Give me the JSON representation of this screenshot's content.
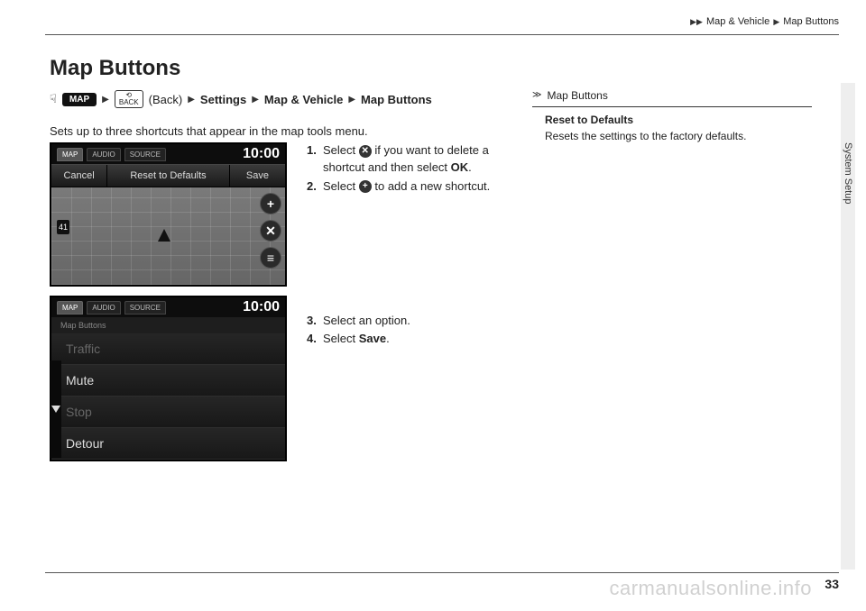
{
  "header": {
    "crumb1": "Map & Vehicle",
    "crumb2": "Map Buttons"
  },
  "title": "Map Buttons",
  "breadcrumb": {
    "map_pill": "MAP",
    "back_box_top": "⟲",
    "back_box_bottom": "BACK",
    "back_label": "(Back)",
    "settings": "Settings",
    "map_vehicle": "Map & Vehicle",
    "map_buttons": "Map Buttons"
  },
  "intro": "Sets up to three shortcuts that appear in the map tools menu.",
  "screenshot1": {
    "tabs": [
      "MAP",
      "AUDIO",
      "SOURCE"
    ],
    "clock": "10:00",
    "toolbar": {
      "cancel": "Cancel",
      "reset": "Reset to Defaults",
      "save": "Save"
    },
    "route_badge": "41",
    "side_icons": [
      "+",
      "✕",
      "≡"
    ]
  },
  "screenshot2": {
    "tabs": [
      "MAP",
      "AUDIO",
      "SOURCE"
    ],
    "clock": "10:00",
    "subtitle": "Map Buttons",
    "items": [
      "Traffic",
      "Mute",
      "Stop",
      "Detour"
    ]
  },
  "steps": {
    "s1_a": "Select ",
    "s1_b": " if you want to delete a shortcut and then select ",
    "s1_ok": "OK",
    "s1_c": ".",
    "s2_a": "Select ",
    "s2_b": " to add a new shortcut.",
    "s3": "Select an option.",
    "s4_a": "Select ",
    "s4_save": "Save",
    "s4_b": "."
  },
  "sidebar": {
    "heading": "Map Buttons",
    "term": "Reset to Defaults",
    "desc": "Resets the settings to the factory defaults."
  },
  "side_label": "System Setup",
  "page_number": "33",
  "watermark": "carmanualsonline.info"
}
